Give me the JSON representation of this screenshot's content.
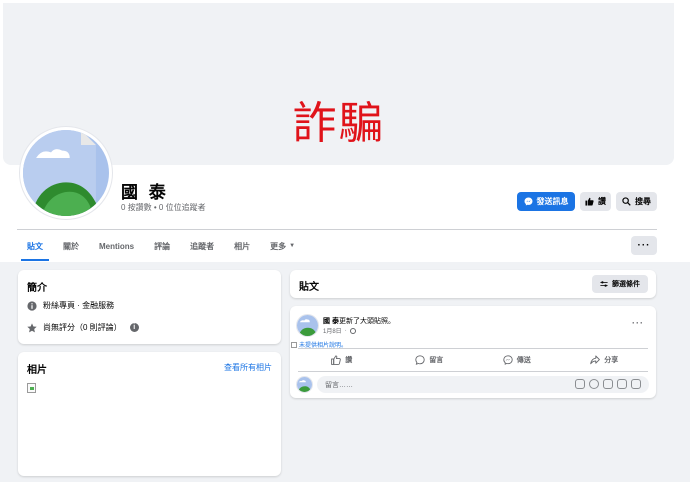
{
  "cover": {
    "text": "詐騙"
  },
  "page": {
    "name": "國 泰",
    "stats": "0 按讚數 • 0 位位追蹤者"
  },
  "header_buttons": {
    "message": "發送訊息",
    "like": "讚",
    "search": "搜尋",
    "more": "···"
  },
  "tabs": [
    {
      "label": "貼文"
    },
    {
      "label": "關於"
    },
    {
      "label": "Mentions"
    },
    {
      "label": "評論"
    },
    {
      "label": "追蹤者"
    },
    {
      "label": "相片"
    },
    {
      "label": "更多"
    }
  ],
  "intro": {
    "title": "簡介",
    "category": "粉絲專頁 · 金融服務",
    "rating": "尚無評分（0 則評論）"
  },
  "photos": {
    "title": "相片",
    "see_all": "查看所有相片"
  },
  "posts": {
    "title": "貼文",
    "filter": "篩選條件"
  },
  "post": {
    "author": "國 泰",
    "action_text": "更新了大頭貼照。",
    "date": "1月8日",
    "alt_text": "未提供相片說明。",
    "more": "···",
    "actions": [
      "讚",
      "留言",
      "傳送",
      "分享"
    ],
    "comment_placeholder": "留言……"
  },
  "colors": {
    "accent": "#1b74e4",
    "cover_text": "#e0131a",
    "background": "#f0f2f5"
  }
}
